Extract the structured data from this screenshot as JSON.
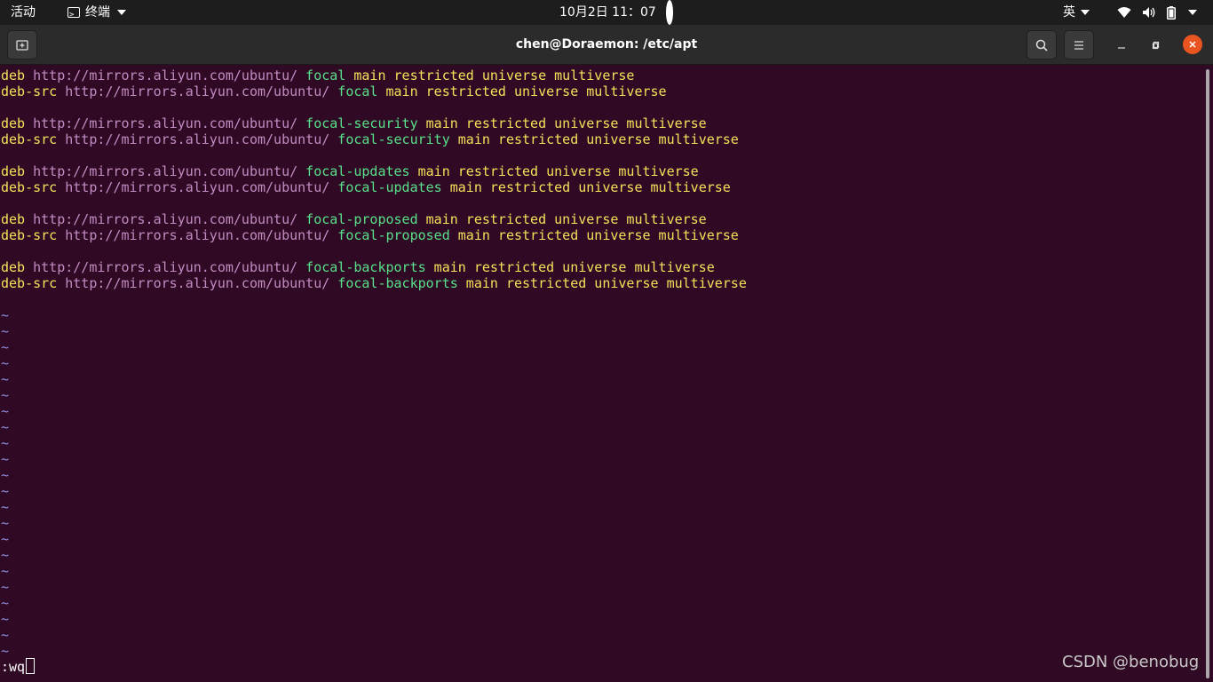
{
  "topbar": {
    "activities": "活动",
    "app_menu": "终端",
    "clock": "10月2日  11：07",
    "input_method": "英"
  },
  "window": {
    "title": "chen@Doraemon: /etc/apt"
  },
  "editor": {
    "lines": [
      {
        "type": "deb",
        "url": "http://mirrors.aliyun.com/ubuntu/",
        "suite": "focal",
        "components": "main restricted universe multiverse"
      },
      {
        "type": "deb-src",
        "url": "http://mirrors.aliyun.com/ubuntu/",
        "suite": "focal",
        "components": "main restricted universe multiverse"
      },
      {
        "type": "",
        "url": "",
        "suite": "",
        "components": ""
      },
      {
        "type": "deb",
        "url": "http://mirrors.aliyun.com/ubuntu/",
        "suite": "focal-security",
        "components": "main restricted universe multiverse"
      },
      {
        "type": "deb-src",
        "url": "http://mirrors.aliyun.com/ubuntu/",
        "suite": "focal-security",
        "components": "main restricted universe multiverse"
      },
      {
        "type": "",
        "url": "",
        "suite": "",
        "components": ""
      },
      {
        "type": "deb",
        "url": "http://mirrors.aliyun.com/ubuntu/",
        "suite": "focal-updates",
        "components": "main restricted universe multiverse"
      },
      {
        "type": "deb-src",
        "url": "http://mirrors.aliyun.com/ubuntu/",
        "suite": "focal-updates",
        "components": "main restricted universe multiverse"
      },
      {
        "type": "",
        "url": "",
        "suite": "",
        "components": ""
      },
      {
        "type": "deb",
        "url": "http://mirrors.aliyun.com/ubuntu/",
        "suite": "focal-proposed",
        "components": "main restricted universe multiverse"
      },
      {
        "type": "deb-src",
        "url": "http://mirrors.aliyun.com/ubuntu/",
        "suite": "focal-proposed",
        "components": "main restricted universe multiverse"
      },
      {
        "type": "",
        "url": "",
        "suite": "",
        "components": ""
      },
      {
        "type": "deb",
        "url": "http://mirrors.aliyun.com/ubuntu/",
        "suite": "focal-backports",
        "components": "main restricted universe multiverse"
      },
      {
        "type": "deb-src",
        "url": "http://mirrors.aliyun.com/ubuntu/",
        "suite": "focal-backports",
        "components": "main restricted universe multiverse"
      },
      {
        "type": "",
        "url": "",
        "suite": "",
        "components": ""
      }
    ],
    "tilde_char": "~",
    "tilde_count": 22,
    "command": ":wq"
  },
  "watermark": "CSDN @benobug",
  "colors": {
    "terminal_bg": "#300a24",
    "keyword": "#f6e05a",
    "url": "#c28bc2",
    "suite": "#58e08a",
    "tilde": "#8f8fdc",
    "close_button": "#e95420"
  },
  "icons": {
    "new_tab": "new-tab-icon",
    "search": "search-icon",
    "menu": "hamburger-menu-icon",
    "minimize": "minimize-icon",
    "maximize": "maximize-icon",
    "close": "close-icon",
    "wifi": "wifi-icon",
    "volume": "volume-icon",
    "battery": "battery-icon"
  }
}
